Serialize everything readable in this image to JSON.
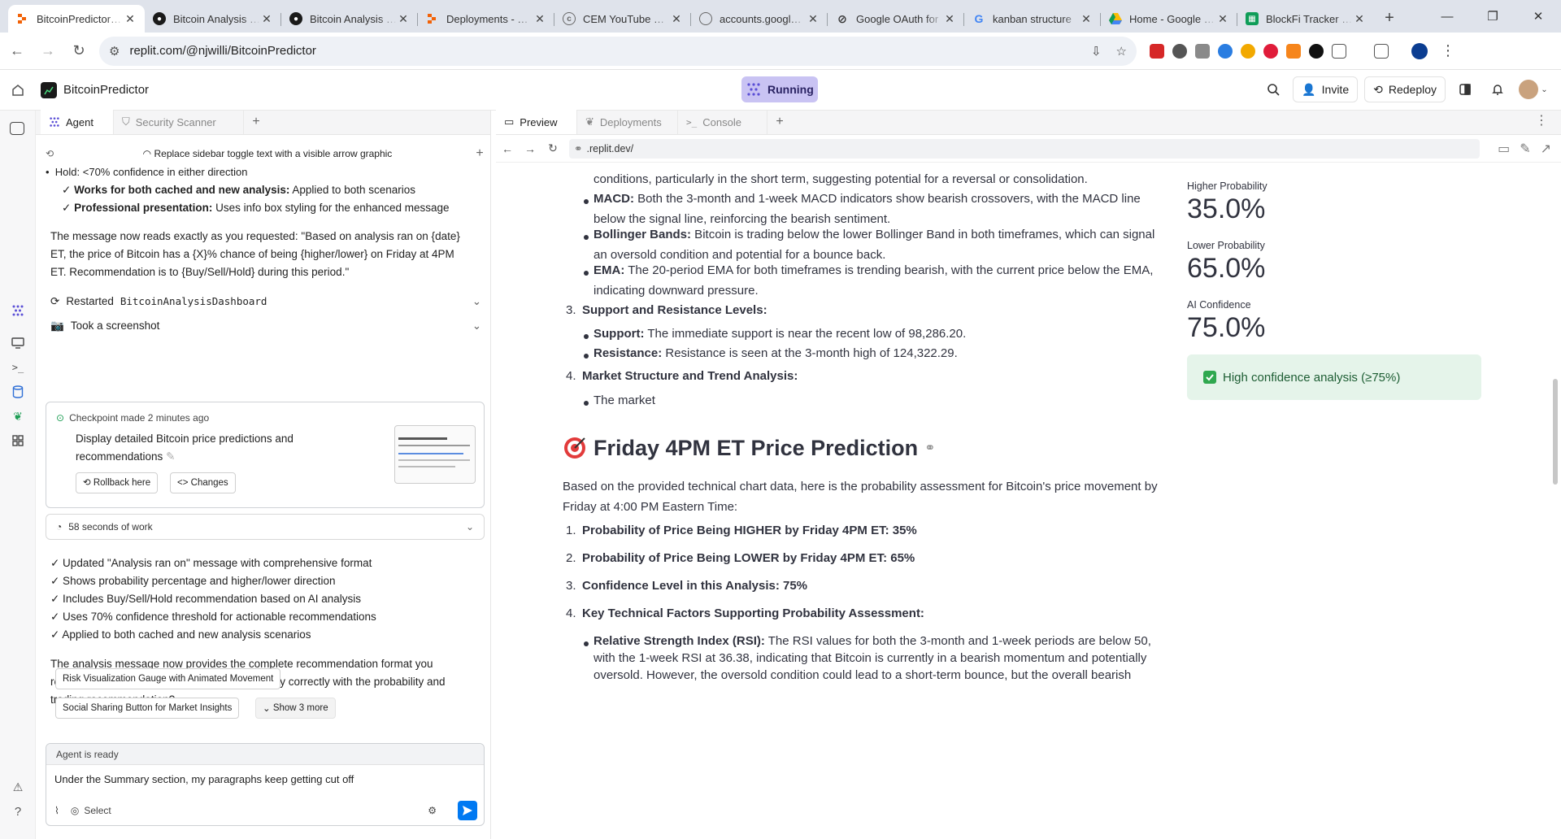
{
  "browser": {
    "tabs": [
      {
        "title": "BitcoinPredictor - Replit",
        "icon": "replit-icon",
        "active": true
      },
      {
        "title": "Bitcoin Analysis Dashboard",
        "icon": "github-icon"
      },
      {
        "title": "Bitcoin Analysis Dashboard",
        "icon": "github-icon"
      },
      {
        "title": "Deployments - Replit",
        "icon": "replit-icon"
      },
      {
        "title": "CEM YouTube Live",
        "icon": "cem-icon"
      },
      {
        "title": "accounts.google.com",
        "icon": "globe-icon"
      },
      {
        "title": "Google OAuth for",
        "icon": "oauth-icon"
      },
      {
        "title": "kanban structure",
        "icon": "google-icon"
      },
      {
        "title": "Home - Google Drive",
        "icon": "drive-icon"
      },
      {
        "title": "BlockFi Tracker - Google Sheets",
        "icon": "sheets-icon"
      }
    ],
    "url": "replit.com/@njwilli/BitcoinPredictor"
  },
  "header": {
    "app_name": "BitcoinPredictor",
    "run_status": "Running",
    "invite_label": "Invite",
    "redeploy_label": "Redeploy"
  },
  "agent": {
    "tabs": [
      "Agent",
      "Security Scanner"
    ],
    "history_title": "Replace sidebar toggle text with a visible arrow graphic",
    "feed": {
      "hold_line": "Hold: <70% confidence in either direction",
      "check1_bold": "Works for both cached and new analysis:",
      "check1_rest": " Applied to both scenarios",
      "check2_bold": "Professional presentation:",
      "check2_rest": " Uses info box styling for the enhanced message",
      "message_l1": "The message now reads exactly as you requested: \"Based on analysis ran on {date}",
      "message_l2": "ET, the price of Bitcoin has a {X}% chance of being {higher/lower} on Friday at 4PM",
      "message_l3": "ET. Recommendation is to {Buy/Sell/Hold} during this period.\"",
      "restarted_label": "Restarted",
      "restarted_name": "BitcoinAnalysisDashboard",
      "screenshot_label": "Took a screenshot"
    },
    "checkpoint": {
      "made": "Checkpoint made 2 minutes ago",
      "desc_l1": "Display detailed Bitcoin price predictions and",
      "desc_l2": "recommendations",
      "rollback_label": "Rollback here",
      "changes_label": "Changes"
    },
    "work_label": "58 seconds of work",
    "updates": [
      "✓ Updated \"Analysis ran on\" message with comprehensive format",
      "✓ Shows probability percentage and higher/lower direction",
      "✓ Includes Buy/Sell/Hold recommendation based on AI analysis",
      "✓ Uses 70% confidence threshold for actionable recommendations",
      "✓ Applied to both cached and new analysis scenarios"
    ],
    "closing_l1": "The analysis message now provides the complete recommendation format you",
    "closing_l2": "requested. Does the enhanced message display correctly with the probability and",
    "closing_l3": "trading recommendation?",
    "suggestions": [
      "Risk Visualization Gauge with Animated Movement",
      "Social Sharing Button for Market Insights"
    ],
    "show_more": "Show 3 more",
    "input": {
      "status": "Agent is ready",
      "value": "Under the Summary section, my paragraphs keep getting cut off",
      "select_label": "Select"
    }
  },
  "preview": {
    "tabs": [
      "Preview",
      "Deployments",
      "Console"
    ],
    "url": ".replit.dev/",
    "content": {
      "cont_line": "conditions, particularly in the short term, suggesting potential for a reversal or consolidation.",
      "macd_bold": "MACD:",
      "macd_l1": " Both the 3-month and 1-week MACD indicators show bearish crossovers, with the MACD line",
      "macd_l2": "below the signal line, reinforcing the bearish sentiment.",
      "bb_bold": "Bollinger Bands:",
      "bb_l1": " Bitcoin is trading below the lower Bollinger Band in both timeframes, which can signal",
      "bb_l2": "an oversold condition and potential for a bounce back.",
      "ema_bold": "EMA:",
      "ema_l1": " The 20-period EMA for both timeframes is trending bearish, with the current price below the EMA,",
      "ema_l2": "indicating downward pressure.",
      "sr_num": "3.",
      "sr_title": "Support and Resistance Levels:",
      "sup_bold": "Support:",
      "sup_rest": " The immediate support is near the recent low of 98,286.20.",
      "res_bold": "Resistance:",
      "res_rest": " Resistance is seen at the 3-month high of 124,322.29.",
      "ms_num": "4.",
      "ms_title": "Market Structure and Trend Analysis:",
      "market": "The market",
      "pred_title": "Friday 4PM ET Price Prediction",
      "pred_intro_l1": "Based on the provided technical chart data, here is the probability assessment for Bitcoin's price movement by",
      "pred_intro_l2": "Friday at 4:00 PM Eastern Time:",
      "p1_num": "1.",
      "p1": "Probability of Price Being HIGHER by Friday 4PM ET: 35%",
      "p2_num": "2.",
      "p2": "Probability of Price Being LOWER by Friday 4PM ET: 65%",
      "p3_num": "3.",
      "p3": "Confidence Level in this Analysis: 75%",
      "p4_num": "4.",
      "p4": "Key Technical Factors Supporting Probability Assessment:",
      "rsi_bold": "Relative Strength Index (RSI):",
      "rsi_l1": " The RSI values for both the 3-month and 1-week periods are below 50,",
      "rsi_l2": "with the 1-week RSI at 36.38, indicating that Bitcoin is currently in a bearish momentum and potentially",
      "rsi_l3": "oversold. However, the oversold condition could lead to a short-term bounce, but the overall bearish"
    },
    "metrics": [
      {
        "label": "Higher Probability",
        "value": "35.0%"
      },
      {
        "label": "Lower Probability",
        "value": "65.0%"
      },
      {
        "label": "AI Confidence",
        "value": "75.0%"
      }
    ],
    "confidence_msg": "High confidence analysis (≥75%)"
  },
  "colors": {
    "accent": "#0079f2",
    "running_bg": "#c9c3f3",
    "success_bg": "#e5f4ea"
  }
}
